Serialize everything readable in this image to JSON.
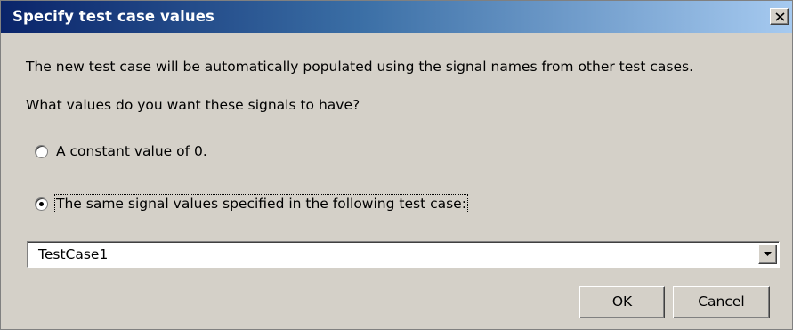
{
  "dialog": {
    "title": "Specify test case values",
    "close_label": "X",
    "intro_text": "The new test case will be automatically populated using the signal names from other test cases.",
    "question_text": "What values do you want these signals to have?"
  },
  "options": [
    {
      "label": "A constant value of 0.",
      "selected": false
    },
    {
      "label": "The same signal values specified in the following test case:",
      "selected": true
    }
  ],
  "test_case_select": {
    "value": "TestCase1"
  },
  "buttons": {
    "ok_label": "OK",
    "cancel_label": "Cancel"
  },
  "icons": {
    "close": "close-icon",
    "dropdown": "chevron-down-icon"
  },
  "colors": {
    "titlebar_start": "#0a246a",
    "titlebar_end": "#a6caf0",
    "dialog_background": "#d4d0c8"
  }
}
